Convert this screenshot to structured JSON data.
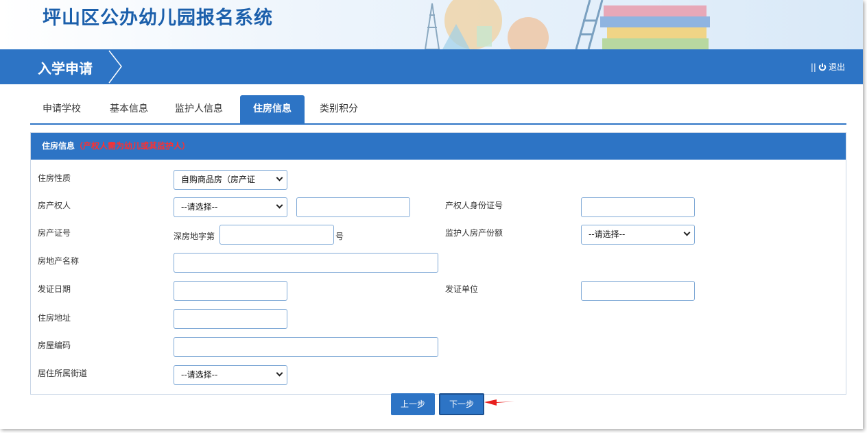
{
  "header": {
    "title": "坪山区公办幼儿园报名系统"
  },
  "navbar": {
    "breadcrumb": "入学申请",
    "logout_label": "退出"
  },
  "tabs": [
    {
      "label": "申请学校",
      "active": false
    },
    {
      "label": "基本信息",
      "active": false
    },
    {
      "label": "监护人信息",
      "active": false
    },
    {
      "label": "住房信息",
      "active": true
    },
    {
      "label": "类别积分",
      "active": false
    }
  ],
  "panel": {
    "title": "住房信息",
    "note": "（产权人需为幼儿或其监护人）"
  },
  "form": {
    "housing_type": {
      "label": "住房性质",
      "value": "自购商品房（房产证"
    },
    "owner": {
      "label": "房产权人",
      "select_value": "--请选择--",
      "input_value": ""
    },
    "owner_id": {
      "label": "产权人身份证号",
      "value": ""
    },
    "cert_no": {
      "label": "房产证号",
      "prefix": "深房地字第",
      "suffix": "号",
      "value": ""
    },
    "guardian_share": {
      "label": "监护人房产份额",
      "value": "--请选择--"
    },
    "estate_name": {
      "label": "房地产名称",
      "value": ""
    },
    "issue_date": {
      "label": "发证日期",
      "value": ""
    },
    "issuer": {
      "label": "发证单位",
      "value": ""
    },
    "address": {
      "label": "住房地址",
      "value": ""
    },
    "house_code": {
      "label": "房屋编码",
      "value": ""
    },
    "street": {
      "label": "居住所属街道",
      "value": "--请选择--"
    }
  },
  "buttons": {
    "prev": "上一步",
    "next": "下一步"
  },
  "colors": {
    "primary": "#2d74c5",
    "title": "#1b5fab",
    "note": "#ff2f2f",
    "arrow": "#e8201f"
  }
}
